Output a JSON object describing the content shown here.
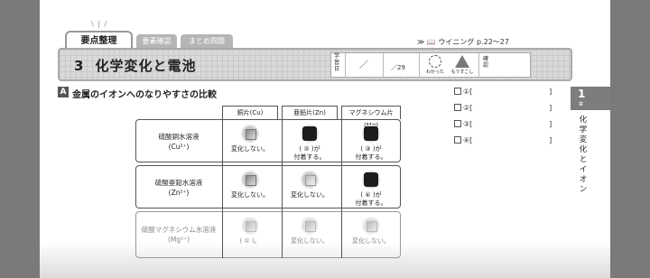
{
  "tabs": {
    "main": "要点整理",
    "second": "要素確認",
    "third": "まとめ問題"
  },
  "reference": {
    "prefix": "≫",
    "label": "ウイニング p.22〜27"
  },
  "chapter": {
    "number": "3",
    "title": "化学変化と電池"
  },
  "study": {
    "date_label": "学習日",
    "slash": "／",
    "score": "／29",
    "wakatta": "わかった",
    "mousukoshi": "もうすこし",
    "kakunin": "確認"
  },
  "section": {
    "mark": "A",
    "title": "金属のイオンへのなりやすさの比較"
  },
  "table": {
    "columns": [
      "銅片(Cu)",
      "亜鉛片(Zn)",
      "マグネシウム片(Mg)"
    ],
    "rows": [
      {
        "label": "硫酸銅水溶液",
        "ion": "(Cu²⁺)",
        "cells": [
          "変化しない。",
          "( ② )が\n付着する。",
          "( ③ )が\n付着する。"
        ]
      },
      {
        "label": "硫酸亜鉛水溶液",
        "ion": "(Zn²⁺)",
        "cells": [
          "変化しない。",
          "変化しない。",
          "( ④ )が\n付着する。"
        ]
      },
      {
        "label": "硫酸マグネシウム水溶液",
        "ion": "(Mg²⁺)",
        "cells": [
          "( ① )。",
          "変化しない。",
          "変化しない。"
        ]
      }
    ]
  },
  "answers": [
    "①[",
    "②[",
    "③[",
    "④["
  ],
  "answer_close": "]",
  "side": {
    "number": "1",
    "chapter": "章",
    "vertical": "化学変化とイオン"
  }
}
